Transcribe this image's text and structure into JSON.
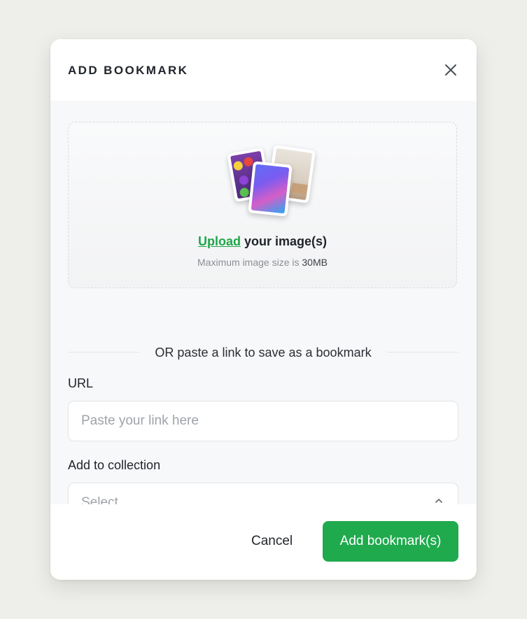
{
  "modal": {
    "title": "ADD BOOKMARK",
    "close_icon": "close-icon"
  },
  "dropzone": {
    "upload_link": "Upload",
    "upload_suffix": " your image(s)",
    "size_prefix": "Maximum image size is ",
    "size_value": "30MB"
  },
  "divider_text": "OR paste a link to save as a bookmark",
  "url_field": {
    "label": "URL",
    "placeholder": "Paste your link here",
    "value": ""
  },
  "collection_field": {
    "label": "Add to collection",
    "selected": "Select",
    "icon": "chevron-up-down-icon"
  },
  "footer": {
    "cancel_label": "Cancel",
    "submit_label": "Add bookmark(s)"
  },
  "colors": {
    "accent": "#1faa4e",
    "page_bg": "#eeeeeb",
    "modal_body_bg": "#f7f8f9"
  }
}
